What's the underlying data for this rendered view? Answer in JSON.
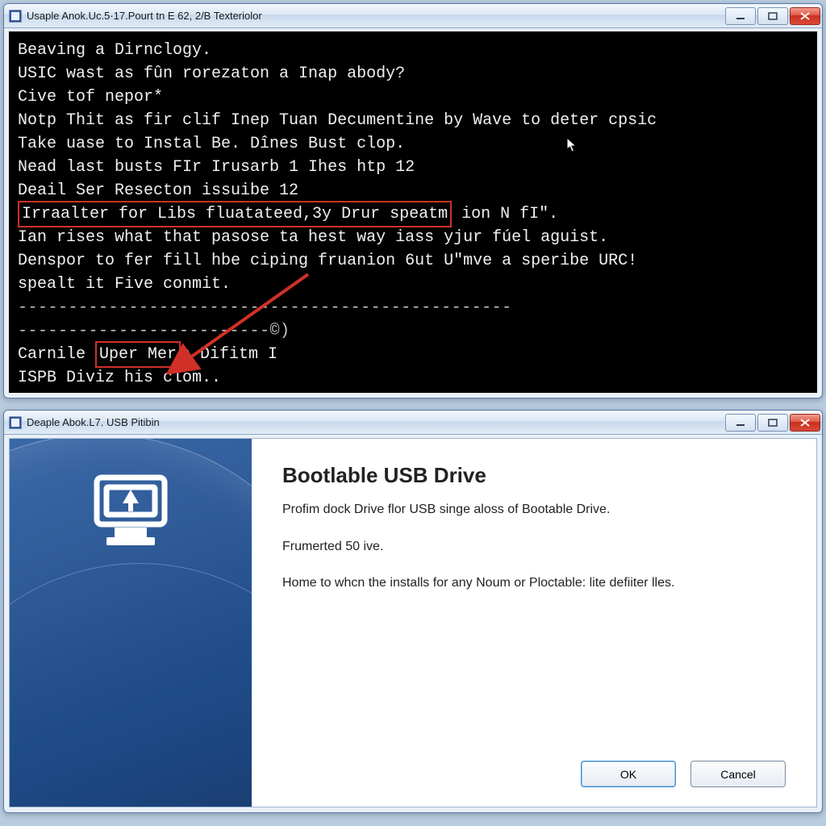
{
  "console_window": {
    "title": "Usaple Anok.Uc.5·17.Pourt tn E 62, 2/B Texteriolor",
    "lines": [
      "Beaving a Dirnclogy.",
      "",
      "USIC wast as fûn rorezaton a Inap abody?",
      "",
      "Cive tof nepor*",
      "Notp Thit as fir clif Inep Tuan Decumentine by Wave to deter cpsic",
      "Take uase to Instal Be. Dînes Bust clop.",
      "",
      "Nead last busts FIr Irusarb 1 Ihes htp 12",
      "",
      "Deail Ser Resecton issuibe 12",
      ""
    ],
    "hl_line_prefix": "Irraalter for Libs fluatateed,3y Drur speatm",
    "hl_line_suffix": " ion N fI\".",
    "more_lines": [
      "Ian rises what that pasose ta hest way iass yjur fúel aguist.",
      "Denspor to fer fill hbe ciping fruanion 6ut U\"mve a speribe URC!",
      "spealt it Five conmit.",
      "-------------------------------------------------",
      "-------------------------©)",
      ""
    ],
    "hl2_prefix": "Carnile ",
    "hl2_text": "Uper Mer",
    "hl2_suffix": "s Difitm I",
    "last_line": "ISPB Diviz his clom.."
  },
  "wizard_window": {
    "title": "Deaple Abok.L7. USB Pitibin",
    "heading": "Bootlable USB Drive",
    "para1": "Profim dock Drive flor USB singe aloss of Bootable Drive.",
    "para2": "Frumerted 50 ive.",
    "para3": "Home to whcn the installs for any Noum or Ploctable: lite defiiter lles.",
    "ok_label": "OK",
    "cancel_label": "Cancel"
  }
}
